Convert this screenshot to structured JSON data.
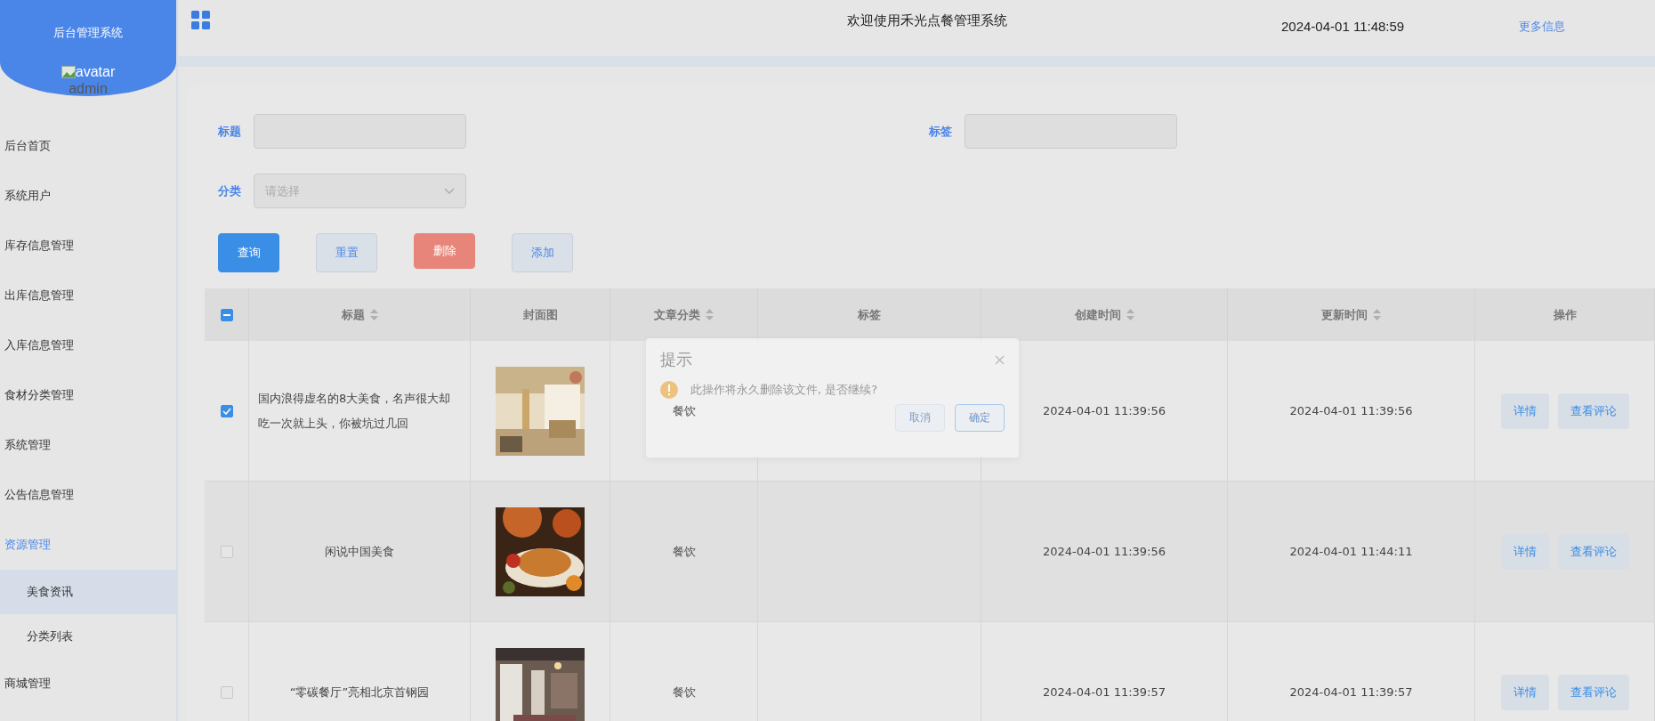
{
  "sidebar": {
    "title": "后台管理系统",
    "avatar_alt": "avatar",
    "username": "admin",
    "menu": [
      {
        "label": "后台首页",
        "expanded": false
      },
      {
        "label": "系统用户",
        "expanded": false
      },
      {
        "label": "库存信息管理",
        "expanded": false
      },
      {
        "label": "出库信息管理",
        "expanded": false
      },
      {
        "label": "入库信息管理",
        "expanded": false
      },
      {
        "label": "食材分类管理",
        "expanded": false
      },
      {
        "label": "系统管理",
        "expanded": false
      },
      {
        "label": "公告信息管理",
        "expanded": false
      },
      {
        "label": "资源管理",
        "expanded": true,
        "children": [
          {
            "label": "美食资讯",
            "selected": true
          },
          {
            "label": "分类列表",
            "selected": false
          }
        ]
      },
      {
        "label": "商城管理",
        "expanded": false
      }
    ]
  },
  "header": {
    "title": "欢迎使用禾光点餐管理系统",
    "datetime": "2024-04-01 11:48:59",
    "more_link": "更多信息"
  },
  "filters": [
    {
      "label": "标题",
      "kind": "text"
    },
    {
      "label": "标签",
      "kind": "text"
    },
    {
      "label": "分类",
      "kind": "select",
      "placeholder": "请选择"
    }
  ],
  "buttons": [
    {
      "label": "查询",
      "kind": "primary"
    },
    {
      "label": "重置",
      "kind": "plain"
    },
    {
      "label": "删除",
      "kind": "danger"
    },
    {
      "label": "添加",
      "kind": "plain"
    }
  ],
  "table": {
    "select_all": {
      "indeterminate": true
    },
    "columns": [
      {
        "label": "标题",
        "sortable": true
      },
      {
        "label": "封面图",
        "sortable": false
      },
      {
        "label": "文章分类",
        "sortable": true
      },
      {
        "label": "标签",
        "sortable": false
      },
      {
        "label": "创建时间",
        "sortable": true
      },
      {
        "label": "更新时间",
        "sortable": true
      },
      {
        "label": "操作",
        "sortable": false
      }
    ],
    "rows": [
      {
        "checked": true,
        "title": "国内浪得虚名的8大美食，名声很大却吃一次就上头，你被坑过几回",
        "cover": {
          "kind": "picture"
        },
        "category": "餐饮",
        "created": "2024-04-01 11:39:56",
        "updated": "2024-04-01 11:39:56",
        "actions": [
          "详情",
          "查看评论"
        ]
      },
      {
        "checked": false,
        "title": "闲说中国美食",
        "cover": {
          "kind": "picture"
        },
        "category": "餐饮",
        "created": "2024-04-01 11:39:56",
        "updated": "2024-04-01 11:44:11",
        "actions": [
          "详情",
          "查看评论"
        ]
      },
      {
        "checked": false,
        "title": "“零碳餐厅”亮相北京首钢园",
        "cover": {
          "kind": "picture"
        },
        "category": "餐饮",
        "created": "2024-04-01 11:39:57",
        "updated": "2024-04-01 11:39:57",
        "actions": [
          "详情",
          "查看评论"
        ]
      }
    ]
  },
  "dialog": {
    "title": "提示",
    "message": "此操作将永久删除该文件, 是否继续?",
    "buttons": [
      {
        "label": "取消",
        "kind": "plain"
      },
      {
        "label": "确定",
        "kind": "primary"
      }
    ]
  }
}
